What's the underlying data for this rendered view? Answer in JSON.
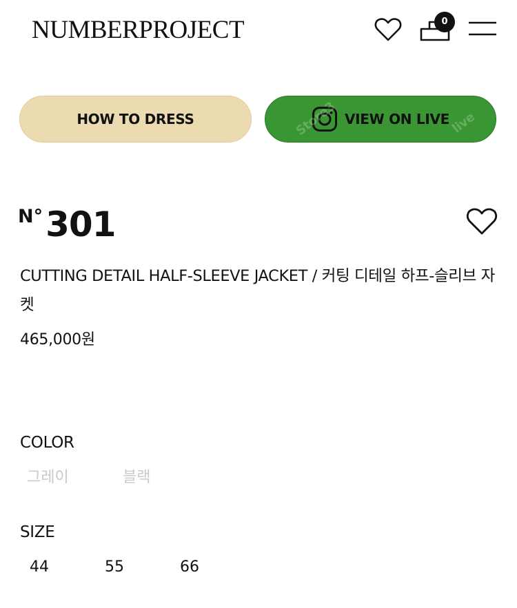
{
  "header": {
    "logo": "NUMBERPROJECT",
    "wishlist_icon": "heart-outline-icon",
    "cart_icon": "bag-icon",
    "cart_count": "0",
    "menu_icon": "hamburger-menu-icon"
  },
  "buttons": {
    "how_to_dress": "HOW TO DRESS",
    "view_on_live": "VIEW ON LIVE",
    "view_on_live_icon": "instagram-icon",
    "how_to_dress_color": "#ecdbb0",
    "view_on_live_color": "#3a9632"
  },
  "product": {
    "number_sign": "N°",
    "number": "301",
    "name": "CUTTING DETAIL HALF-SLEEVE JACKET / 커팅 디테일 하프-슬리브 자켓",
    "price": "465,000원",
    "wishlist_icon": "heart-outline-icon"
  },
  "options": {
    "color_label": "COLOR",
    "colors": [
      "그레이",
      "블랙"
    ],
    "size_label": "SIZE",
    "sizes": [
      "44",
      "55",
      "66"
    ]
  }
}
